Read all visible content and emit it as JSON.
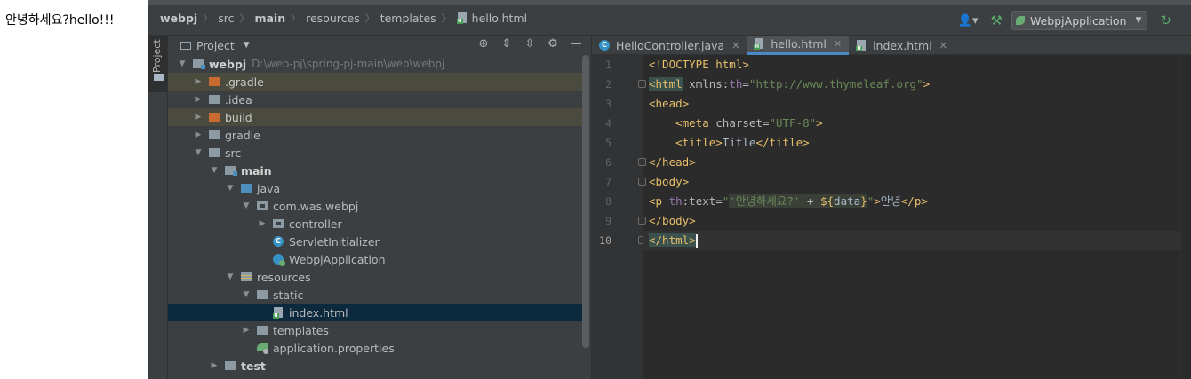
{
  "browser": {
    "text": "안녕하세요?hello!!!"
  },
  "breadcrumb": {
    "items": [
      {
        "label": "webpj",
        "bold": true
      },
      {
        "label": "src",
        "bold": false
      },
      {
        "label": "main",
        "bold": true
      },
      {
        "label": "resources",
        "bold": false
      },
      {
        "label": "templates",
        "bold": false
      },
      {
        "label": "hello.html",
        "bold": false
      }
    ]
  },
  "toolbar": {
    "run_config": "WebpjApplication"
  },
  "strip": {
    "project_tab": "Project"
  },
  "project": {
    "title": "Project",
    "root_name": "webpj",
    "root_path": "D:\\web-pj\\spring-pj-main\\web\\webpj",
    "items": [
      {
        "label": ".gradle"
      },
      {
        "label": ".idea"
      },
      {
        "label": "build"
      },
      {
        "label": "gradle"
      },
      {
        "label": "src"
      },
      {
        "label": "main"
      },
      {
        "label": "java"
      },
      {
        "label": "com.was.webpj"
      },
      {
        "label": "controller"
      },
      {
        "label": "ServletInitializer"
      },
      {
        "label": "WebpjApplication"
      },
      {
        "label": "resources"
      },
      {
        "label": "static"
      },
      {
        "label": "index.html"
      },
      {
        "label": "templates"
      },
      {
        "label": "application.properties"
      },
      {
        "label": "test"
      }
    ]
  },
  "tabs": [
    {
      "label": "HelloController.java",
      "icon": "class-icon"
    },
    {
      "label": "hello.html",
      "icon": "html-file-icon",
      "active": true
    },
    {
      "label": "index.html",
      "icon": "html-file-icon"
    }
  ],
  "editor": {
    "line_numbers": [
      "1",
      "2",
      "3",
      "4",
      "5",
      "6",
      "7",
      "8",
      "9",
      "10"
    ],
    "current_line": 10,
    "code": {
      "l1": {
        "doctype": "<!DOCTYPE html>"
      },
      "l2": {
        "open": "<html",
        "attr_name": " xmlns:",
        "attr_ns": "th",
        "eq": "=",
        "attr_val": "\"http://www.thymeleaf.org\"",
        "close": ">"
      },
      "l3": {
        "tag": "<head>"
      },
      "l4": {
        "indent": "    ",
        "open": "<meta",
        "attr": " charset=",
        "val": "\"UTF-8\"",
        "close": ">"
      },
      "l5": {
        "indent": "    ",
        "open": "<title>",
        "text": "Title",
        "close": "</title>"
      },
      "l6": {
        "tag": "</head>"
      },
      "l7": {
        "tag": "<body>"
      },
      "l8": {
        "open": "<p ",
        "ns": "th",
        "attr": ":text=",
        "q1": "\"",
        "str": "'안녕하세요?'",
        "plus": " + ",
        "expr_open": "${",
        "var": "data",
        "expr_close": "}",
        "q2": "\"",
        "gt": ">",
        "text": "안녕",
        "close": "</p>"
      },
      "l9": {
        "tag": "</body>"
      },
      "l10": {
        "tag": "</html>"
      }
    }
  }
}
